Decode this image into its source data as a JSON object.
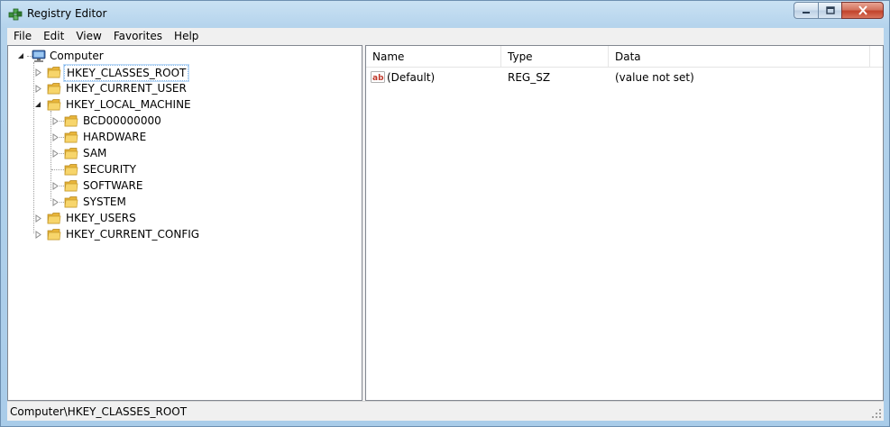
{
  "window": {
    "title": "Registry Editor",
    "icon": "regedit-icon",
    "buttons": [
      "minimize",
      "maximize",
      "close"
    ]
  },
  "menubar": {
    "items": [
      "File",
      "Edit",
      "View",
      "Favorites",
      "Help"
    ]
  },
  "tree": {
    "root": "Computer",
    "items": [
      {
        "label": "HKEY_CLASSES_ROOT",
        "level": 1,
        "expander": "collapsed",
        "selected": true
      },
      {
        "label": "HKEY_CURRENT_USER",
        "level": 1,
        "expander": "collapsed"
      },
      {
        "label": "HKEY_LOCAL_MACHINE",
        "level": 1,
        "expander": "expanded"
      },
      {
        "label": "BCD00000000",
        "level": 2,
        "expander": "collapsed"
      },
      {
        "label": "HARDWARE",
        "level": 2,
        "expander": "collapsed"
      },
      {
        "label": "SAM",
        "level": 2,
        "expander": "collapsed"
      },
      {
        "label": "SECURITY",
        "level": 2,
        "expander": "none"
      },
      {
        "label": "SOFTWARE",
        "level": 2,
        "expander": "collapsed"
      },
      {
        "label": "SYSTEM",
        "level": 2,
        "expander": "collapsed"
      },
      {
        "label": "HKEY_USERS",
        "level": 1,
        "expander": "collapsed"
      },
      {
        "label": "HKEY_CURRENT_CONFIG",
        "level": 1,
        "expander": "collapsed"
      }
    ]
  },
  "list": {
    "columns": [
      "Name",
      "Type",
      "Data"
    ],
    "rows": [
      {
        "name": "(Default)",
        "type": "REG_SZ",
        "data": "(value not set)",
        "icon": "string-value-icon"
      }
    ]
  },
  "statusbar": {
    "path": "Computer\\HKEY_CLASSES_ROOT"
  },
  "colors": {
    "frame": "#b4d3ec",
    "folder": "#f2c14e",
    "selection_border": "#7eb4ea",
    "close_button": "#c2432b"
  }
}
